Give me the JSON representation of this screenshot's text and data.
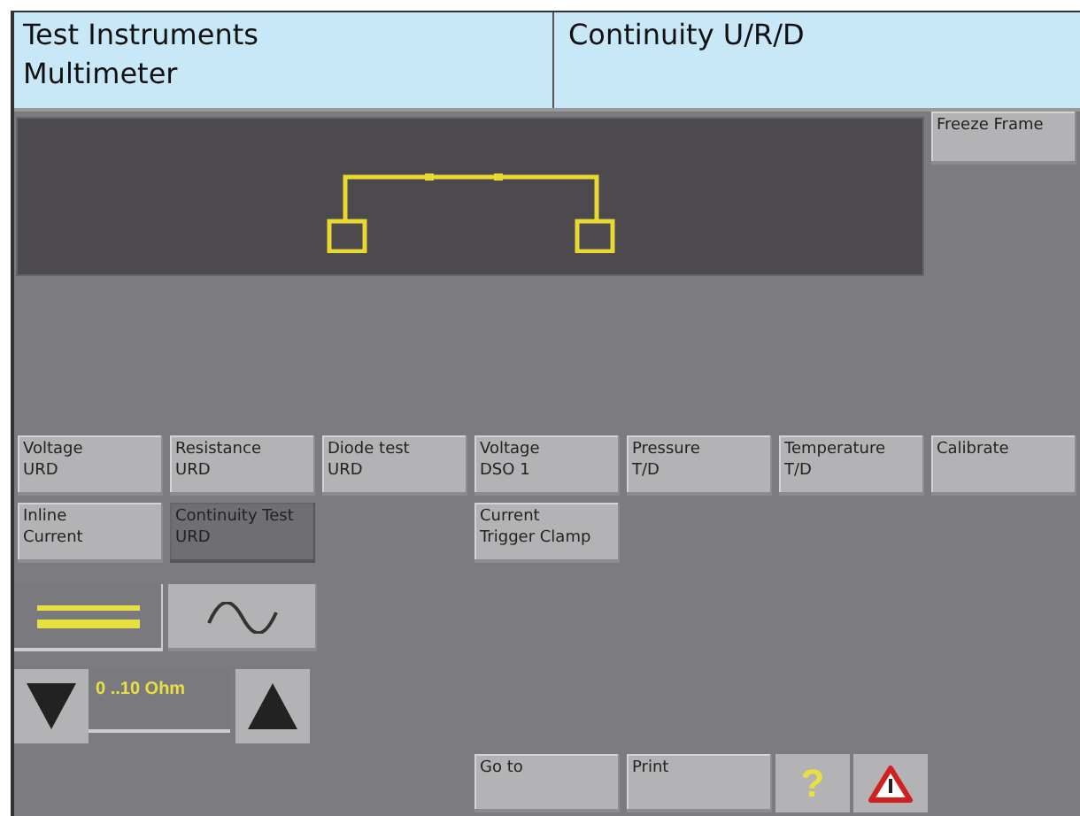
{
  "header": {
    "title": "Test Instruments\nMultimeter",
    "mode": "Continuity U/R/D"
  },
  "freeze_button": "Freeze Frame",
  "functions": [
    {
      "label": "Voltage\nURD",
      "selected": false
    },
    {
      "label": "Resistance\nURD",
      "selected": false
    },
    {
      "label": "Diode test\nURD",
      "selected": false
    },
    {
      "label": "Voltage\nDSO 1",
      "selected": false
    },
    {
      "label": "Pressure\nT/D",
      "selected": false
    },
    {
      "label": "Temperature\nT/D",
      "selected": false
    },
    {
      "label": "Calibrate",
      "selected": false
    },
    {
      "label": "Inline\nCurrent",
      "selected": false
    },
    {
      "label": "Continuity Test\nURD",
      "selected": true
    },
    {
      "label": "Current\nTrigger Clamp",
      "selected": false
    }
  ],
  "coupling": [
    {
      "kind": "dc",
      "selected": true
    },
    {
      "kind": "ac",
      "selected": false
    }
  ],
  "range": {
    "value": "0 ..10 Ohm"
  },
  "bottom_buttons": [
    {
      "label": "Go to"
    },
    {
      "label": "Print"
    }
  ],
  "help_button": "?"
}
